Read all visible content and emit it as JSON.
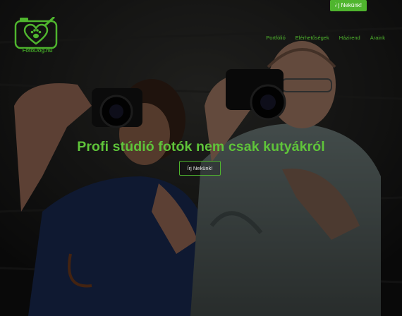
{
  "header": {
    "cta_label": "Írj Nekünk!",
    "social": [
      {
        "icon": "facebook-icon",
        "color": "#4fb52e"
      },
      {
        "icon": "instagram-icon",
        "color": "#4fb52e"
      }
    ]
  },
  "logo": {
    "text": "FotoDog.hu",
    "icon": "camera-heart-paw-icon"
  },
  "nav": {
    "items": [
      {
        "label": "Portfólió"
      },
      {
        "label": "Elérhetőségek"
      },
      {
        "label": "Házirend"
      },
      {
        "label": "Áraink"
      }
    ]
  },
  "hero": {
    "headline": "Profi stúdió fotók nem csak kutyákról",
    "cta_label": "Írj Nekünk!",
    "image": "two-photographers-with-cameras"
  },
  "colors": {
    "brand_green": "#4fb52e",
    "headline_green": "#5fc43a",
    "overlay": "#000000"
  }
}
